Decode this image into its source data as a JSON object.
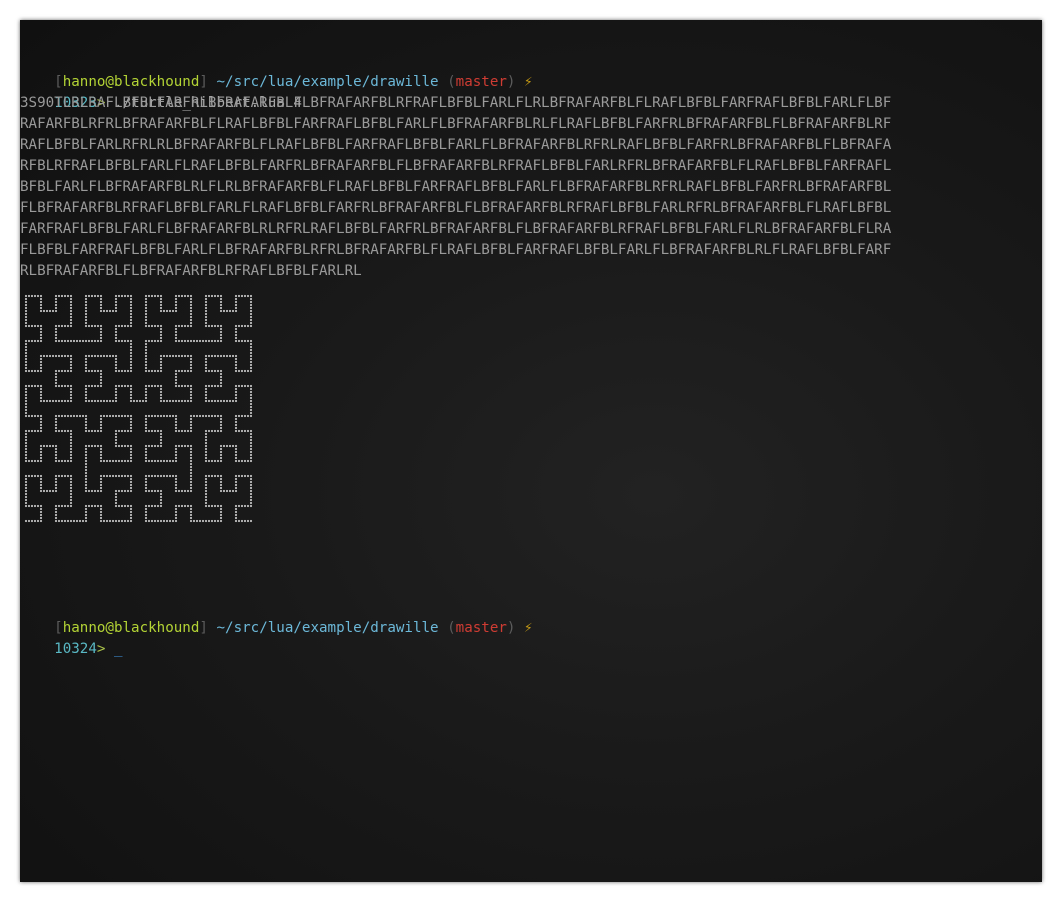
{
  "prompt1": {
    "user_host": "hanno@blackhound",
    "path": "~/src/lua/example/drawille",
    "branch": "master",
    "status_icon": "lightning-bolt-icon",
    "line_number": "10323",
    "command": "./turtle_hilbert.lua 4"
  },
  "output": {
    "lines": [
      "3S90TLRLRAFLBFBLFARFRLBFRAFARFBLFLBFRAFARFBLRFRAFLBFBLFARLFLRLBFRAFARFBLFLRAFLBFBLFARFRAFLBFBLFARLFLBF",
      "RAFARFBLRFRLBFRAFARFBLFLRAFLBFBLFARFRAFLBFBLFARLFLBFRAFARFBLRLFLRAFLBFBLFARFRLBFRAFARFBLFLBFRAFARFBLRF",
      "RAFLBFBLFARLRFRLRLBFRAFARFBLFLRAFLBFBLFARFRAFLBFBLFARLFLBFRAFARFBLRFRLRAFLBFBLFARFRLBFRAFARFBLFLBFRAFA",
      "RFBLRFRAFLBFBLFARLFLRAFLBFBLFARFRLBFRAFARFBLFLBFRAFARFBLRFRAFLBFBLFARLRFRLBFRAFARFBLFLRAFLBFBLFARFRAFL",
      "BFBLFARLFLBFRAFARFBLRLFLRLBFRAFARFBLFLRAFLBFBLFARFRAFLBFBLFARLFLBFRAFARFBLRFRLRAFLBFBLFARFRLBFRAFARFBL",
      "FLBFRAFARFBLRFRAFLBFBLFARLFLRAFLBFBLFARFRLBFRAFARFBLFLBFRAFARFBLRFRAFLBFBLFARLRFRLBFRAFARFBLFLRAFLBFBL",
      "FARFRAFLBFBLFARLFLBFRAFARFBLRLRFRLRAFLBFBLFARFRLBFRAFARFBLFLBFRAFARFBLRFRAFLBFBLFARLFLRLBFRAFARFBLFLRA",
      "FLBFBLFARFRAFLBFBLFARLFLBFRAFARFBLRFRLBFRAFARFBLFLRAFLBFBLFARFRAFLBFBLFARLFLBFRAFARFBLRLFLRAFLBFBLFARF",
      "RLBFRAFARFBLFLBFRAFARFBLRFRAFLBFBLFARLRL"
    ]
  },
  "prompt2": {
    "user_host": "hanno@blackhound",
    "path": "~/src/lua/example/drawille",
    "branch": "master",
    "status_icon": "lightning-bolt-icon",
    "line_number": "10324",
    "cursor": "_"
  },
  "hilbert_order": 4
}
